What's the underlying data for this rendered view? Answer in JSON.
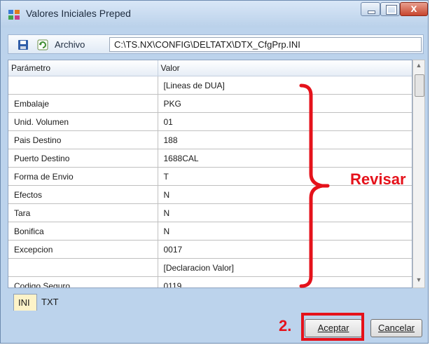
{
  "window": {
    "title": "Valores Iniciales Preped",
    "controls": [
      "minimize",
      "maximize",
      "close"
    ],
    "close_glyph": "x"
  },
  "toolbar": {
    "save_icon": "save-icon",
    "refresh_icon": "refresh-icon",
    "label": "Archivo",
    "path": "C:\\TS.NX\\CONFIG\\DELTATX\\DTX_CfgPrp.INI"
  },
  "grid": {
    "columns": [
      "Parámetro",
      "Valor"
    ],
    "rows": [
      {
        "param": "",
        "value": "[Lineas de DUA]"
      },
      {
        "param": "Embalaje",
        "value": "PKG"
      },
      {
        "param": "Unid. Volumen",
        "value": "01"
      },
      {
        "param": "Pais Destino",
        "value": "188"
      },
      {
        "param": "Puerto Destino",
        "value": "1688CAL"
      },
      {
        "param": "Forma de Envio",
        "value": "T"
      },
      {
        "param": "Efectos",
        "value": "N"
      },
      {
        "param": "Tara",
        "value": "N"
      },
      {
        "param": "Bonifica",
        "value": "N"
      },
      {
        "param": "Excepcion",
        "value": "0017"
      },
      {
        "param": "",
        "value": "[Declaracion Valor]"
      },
      {
        "param": "Codigo Seguro",
        "value": "0119"
      }
    ]
  },
  "tabs": [
    {
      "label": "INI",
      "active": true
    },
    {
      "label": "TXT",
      "active": false
    }
  ],
  "buttons": {
    "accept": "Aceptar",
    "cancel": "Cancelar"
  },
  "annotations": {
    "review_label": "Revisar",
    "step_label": "2.",
    "color": "#e5121b"
  },
  "colors": {
    "title_bg": "#bad1ea",
    "active_tab": "#fdf3c8",
    "annotation": "#e5121b"
  }
}
